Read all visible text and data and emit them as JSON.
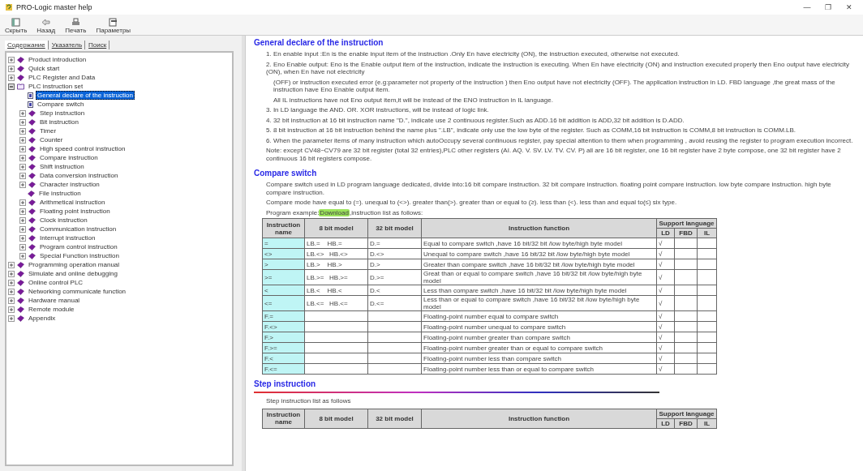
{
  "window": {
    "title": "PRO-Logic master help",
    "controls": [
      "—",
      "❐",
      "✕"
    ]
  },
  "toolbar": [
    {
      "label": "Скрыть"
    },
    {
      "label": "Назад"
    },
    {
      "label": "Печать"
    },
    {
      "label": "Параметры"
    }
  ],
  "nav_tabs": [
    {
      "label": "Содержание",
      "selected": true
    },
    {
      "label": "Указатель",
      "selected": false
    },
    {
      "label": "Поиск",
      "selected": false
    }
  ],
  "tree": [
    {
      "label": "Product introduction",
      "kind": "book",
      "expanded": false,
      "selected": false
    },
    {
      "label": "Quick start",
      "kind": "book",
      "expanded": false,
      "selected": false
    },
    {
      "label": "PLC Register and Data",
      "kind": "book",
      "expanded": false,
      "selected": false
    },
    {
      "label": "PLC instruction set",
      "kind": "book",
      "expanded": true,
      "selected": false,
      "children": [
        {
          "label": "General declare of the instruction",
          "kind": "page",
          "selected": true
        },
        {
          "label": "Compare switch",
          "kind": "page",
          "selected": false
        },
        {
          "label": "Step instruction",
          "kind": "book",
          "expanded": false,
          "selected": false
        },
        {
          "label": "Bit instruction",
          "kind": "book",
          "expanded": false,
          "selected": false
        },
        {
          "label": "Timer",
          "kind": "book",
          "expanded": false,
          "selected": false
        },
        {
          "label": "Counter",
          "kind": "book",
          "expanded": false,
          "selected": false
        },
        {
          "label": "High speed control instruction",
          "kind": "book",
          "expanded": false,
          "selected": false
        },
        {
          "label": "Compare  instruction",
          "kind": "book",
          "expanded": false,
          "selected": false
        },
        {
          "label": "Shift  instruction",
          "kind": "book",
          "expanded": false,
          "selected": false
        },
        {
          "label": "Data conversion instruction",
          "kind": "book",
          "expanded": false,
          "selected": false
        },
        {
          "label": "Character instruction",
          "kind": "book",
          "expanded": false,
          "selected": false
        },
        {
          "label": "File instruction",
          "kind": "leafbook",
          "selected": false
        },
        {
          "label": "Arithmetical instruction",
          "kind": "book",
          "expanded": false,
          "selected": false
        },
        {
          "label": "Floating point instruction",
          "kind": "book",
          "expanded": false,
          "selected": false
        },
        {
          "label": "Clock instruction",
          "kind": "book",
          "expanded": false,
          "selected": false
        },
        {
          "label": "Communication instruction",
          "kind": "book",
          "expanded": false,
          "selected": false
        },
        {
          "label": "Interrupt instruction",
          "kind": "book",
          "expanded": false,
          "selected": false
        },
        {
          "label": "Program control  instruction",
          "kind": "book",
          "expanded": false,
          "selected": false
        },
        {
          "label": "Special Function  instruction",
          "kind": "book",
          "expanded": false,
          "selected": false
        }
      ]
    },
    {
      "label": "Programming operation manual",
      "kind": "book",
      "expanded": false,
      "selected": false
    },
    {
      "label": "Simulate and online debugging",
      "kind": "book",
      "expanded": false,
      "selected": false
    },
    {
      "label": "Online control PLC",
      "kind": "book",
      "expanded": false,
      "selected": false
    },
    {
      "label": "Networking communicate function",
      "kind": "book",
      "expanded": false,
      "selected": false
    },
    {
      "label": "Hardware manual",
      "kind": "book",
      "expanded": false,
      "selected": false
    },
    {
      "label": "Remote module",
      "kind": "book",
      "expanded": false,
      "selected": false
    },
    {
      "label": "Appendix",
      "kind": "book",
      "expanded": false,
      "selected": false
    }
  ],
  "content": {
    "general": {
      "heading": "General declare of the instruction",
      "paragraphs": [
        {
          "kind": "item",
          "text": "1. En enable input :En is the enable input item of the instruction .Only En have electricity (ON), the instruction executed, otherwise not executed."
        },
        {
          "kind": "item",
          "text": "2. Eno Enable output: Eno is the Enable output item of the instruction, indicate the instruction is executing. When En have electricity (ON) and instruction executed properly then Eno output have electricity (ON), when En have not electricity"
        },
        {
          "kind": "sub",
          "text": "(OFF) or instruction executed error (e.g:parameter not property of the instruction ) then Eno output have not electricity (OFF). The application instruction in  LD. FBD language ,the great mass of the instruction have Eno Enable output item."
        },
        {
          "kind": "sub",
          "text": "All IL instructions have not Eno output item,it will be instead of the ENO instruction in IL language."
        },
        {
          "kind": "item",
          "text": "3. In LD language  the AND. OR. XOR instructions, will be instead of logic link."
        },
        {
          "kind": "item",
          "text": "4. 32 bit instruction at 16 bit instruction name \"D.\", indicate use 2 continuous register.Such as ADD.16 bit addition is ADD,32 bit addition is D.ADD."
        },
        {
          "kind": "item",
          "text": "5. 8 bit instruction at 16 bit instruction behind the name plus \".LB\", indicate only use the low byte of the register. Such as COMM,16 bit instruction is COMM,8 bit instruction is COMM.LB."
        },
        {
          "kind": "item",
          "text": "6. When the parameter items of many instruction which autoOccupy  several continuous register, pay special attention to them when programming , avoid reusing the register to program execution incorrect."
        },
        {
          "kind": "item",
          "text": "Note: except CV48~CV79 are 32 bit register (total 32 entries),PLC other registers (AI. AQ. V. SV. LV. TV. CV. P) all are 16 bit register, one 16 bit register have 2 byte compose, one 32 bit register have 2 continuous 16 bit registers compose."
        }
      ]
    },
    "compare": {
      "heading": "Compare switch",
      "paragraphs": [
        "Compare switch used in LD program language dedicated, divide into:16 bit compare instruction. 32 bit compare instruction. floating point compare instruction. low byte compare instruction. high byte compare instruction.",
        "Compare mode have equal to (=). unequal to (<>). greater than(>). greater than or equal to (≥). less than (<). less than and equal to(≤) six type."
      ],
      "example": {
        "before": "Program example:",
        "link": "Download",
        "after": ",instruction list as follows:"
      },
      "table": {
        "columns": [
          "Instruction name",
          "8 bit model",
          "32 bit model",
          "Instruction function",
          "Support language"
        ],
        "sub_columns": [
          "LD",
          "FBD",
          "IL"
        ],
        "rows": [
          [
            "=",
            "LB.=    HB.=",
            "D.=",
            "Equal to compare switch ,have 16 bit/32 bit /low byte/high byte model",
            "√",
            "",
            ""
          ],
          [
            "<>",
            "LB.<>   HB.<>",
            "D.<>",
            "Unequal to compare switch ,have 16 bit/32 bit /low byte/high byte model",
            "√",
            "",
            ""
          ],
          [
            ">",
            "LB.>    HB.>",
            "D.>",
            "Greater than compare switch ,have 16 bit/32 bit /low byte/high byte model",
            "√",
            "",
            ""
          ],
          [
            ">=",
            "LB.>=   HB.>=",
            "D.>=",
            "Great than or equal to compare switch ,have 16 bit/32 bit /low byte/high byte model",
            "√",
            "",
            ""
          ],
          [
            "<",
            "LB.<    HB.<",
            "D.<",
            "Less than compare switch ,have 16 bit/32 bit /low byte/high byte model",
            "√",
            "",
            ""
          ],
          [
            "<=",
            "LB.<=   HB.<=",
            "D.<=",
            "Less than or equal to compare switch ,have 16 bit/32 bit /low byte/high byte model",
            "√",
            "",
            ""
          ],
          [
            "F.=",
            "",
            "",
            "Floating-point number  equal to compare switch",
            "√",
            "",
            ""
          ],
          [
            "F.<>",
            "",
            "",
            "Floating-point number  unequal to compare switch",
            "√",
            "",
            ""
          ],
          [
            "F.>",
            "",
            "",
            "Floating-point number  greater than compare switch",
            "√",
            "",
            ""
          ],
          [
            "F.>=",
            "",
            "",
            "Floating-point number  greater than or equal to compare switch",
            "√",
            "",
            ""
          ],
          [
            "F.<",
            "",
            "",
            "Floating-point number  less than compare switch",
            "√",
            "",
            ""
          ],
          [
            "F.<=",
            "",
            "",
            "Floating-point number  less than or equal to compare switch",
            "√",
            "",
            ""
          ]
        ]
      }
    },
    "step": {
      "heading": "Step instruction",
      "intro": "Step instruction  list as follows",
      "table": {
        "columns": [
          "Instruction name",
          "8 bit model",
          "32 bit model",
          "Instruction function",
          "Support language"
        ],
        "sub_columns": [
          "LD",
          "FBD",
          "IL"
        ]
      }
    }
  }
}
